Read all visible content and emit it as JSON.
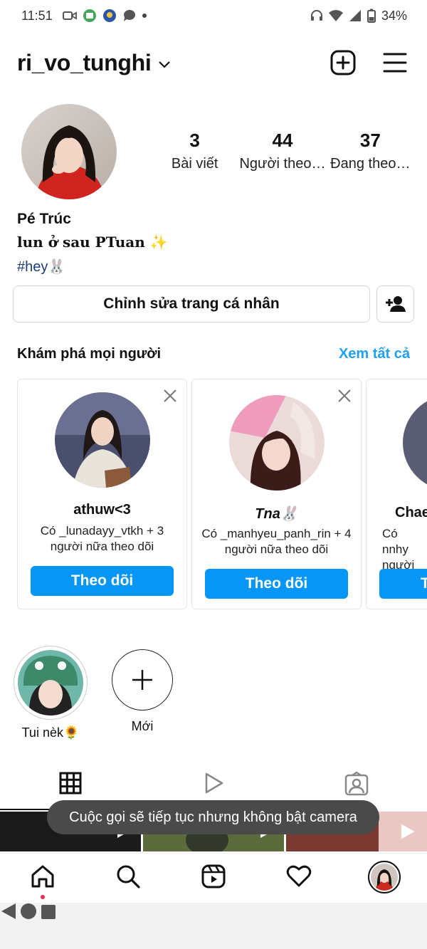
{
  "status_bar": {
    "time": "11:51",
    "battery": "34%"
  },
  "header": {
    "username": "ri_vo_tunghi"
  },
  "profile": {
    "stats": [
      {
        "value": "3",
        "label": "Bài viết"
      },
      {
        "value": "44",
        "label": "Người theo…"
      },
      {
        "value": "37",
        "label": "Đang theo…"
      }
    ],
    "display_name": "Pé Trúc",
    "bio_line": "lun ở sau PTuan ✨",
    "hashtag": "#hey🐰",
    "edit_button": "Chỉnh sửa trang cá nhân"
  },
  "discover": {
    "title": "Khám phá mọi người",
    "see_all": "Xem tất cả",
    "cards": [
      {
        "name": "athuw<3",
        "desc": "Có _lunadayy_vtkh + 3 người nữa theo dõi",
        "follow": "Theo dõi"
      },
      {
        "name": "Tna🐰",
        "desc": "Có _manhyeu_panh_rin + 4 người nữa theo dõi",
        "follow": "Theo dõi"
      },
      {
        "name": "Chae",
        "desc": "Có nnhy người",
        "follow": "T"
      }
    ]
  },
  "highlights": [
    {
      "label": "Tui nèk🌻"
    },
    {
      "label": "Mới"
    }
  ],
  "toast": "Cuộc gọi sẽ tiếp tục nhưng không bật camera",
  "colors": {
    "accent_blue": "#0795f6",
    "link_blue": "#1ea1f1",
    "notification_dot": "#ed2f55"
  },
  "icons": {
    "header": [
      "new-post-icon",
      "menu-icon"
    ],
    "bottom_nav": [
      "home-icon",
      "search-icon",
      "reels-icon",
      "heart-icon",
      "profile-avatar"
    ],
    "profile_tabs": [
      "grid-icon",
      "reels-tab-icon",
      "tagged-icon"
    ]
  }
}
